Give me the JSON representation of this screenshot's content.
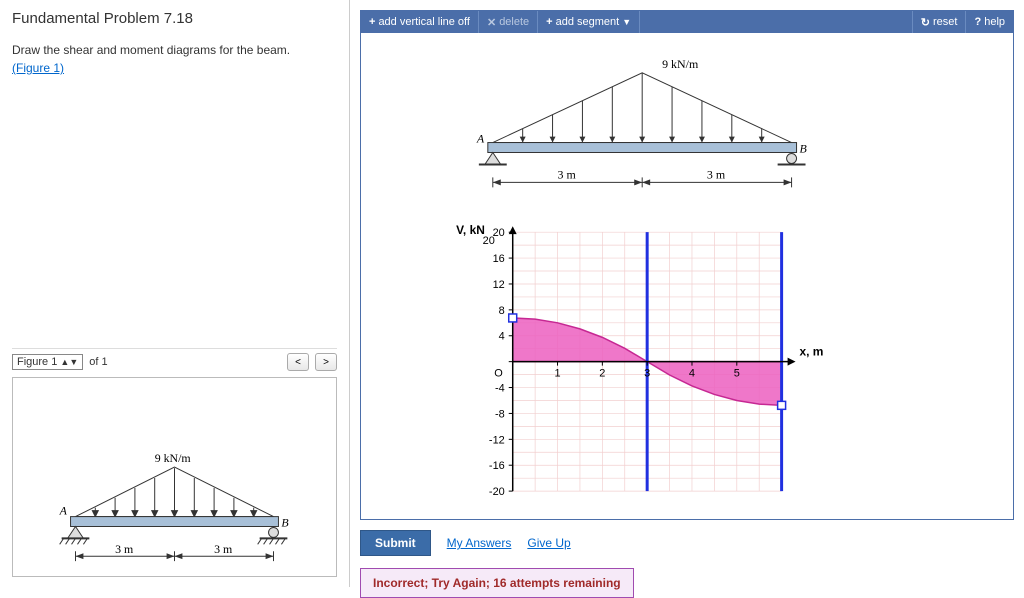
{
  "problem": {
    "title": "Fundamental Problem 7.18",
    "description": "Draw the shear and moment diagrams for the beam.",
    "figure_link": "(Figure 1)"
  },
  "figure_nav": {
    "selected": "Figure 1",
    "of": "of 1",
    "prev": "<",
    "next": ">"
  },
  "beam": {
    "load_label": "9 kN/m",
    "point_A": "A",
    "point_B": "B",
    "span_left": "3 m",
    "span_right": "3 m"
  },
  "toolbar": {
    "add_vline": "add vertical line off",
    "delete": "delete",
    "add_segment": "add segment",
    "reset": "reset",
    "help": "help"
  },
  "chart_data": {
    "type": "line",
    "title": "",
    "xlabel": "x, m",
    "ylabel": "V, kN",
    "xlim": [
      0,
      6
    ],
    "ylim": [
      -20,
      20
    ],
    "xticks": [
      "O",
      "1",
      "2",
      "3",
      "4",
      "5"
    ],
    "yticks": [
      20,
      16,
      12,
      8,
      4,
      0,
      -4,
      -8,
      -12,
      -16,
      -20
    ],
    "x": [
      0,
      0.5,
      1,
      1.5,
      2,
      2.5,
      3,
      3.5,
      4,
      4.5,
      5,
      5.5,
      6
    ],
    "y": [
      6.75,
      6.5625,
      6.0,
      5.0625,
      3.75,
      2.0625,
      0,
      -2.0625,
      -3.75,
      -5.0625,
      -6.0,
      -6.5625,
      -6.75
    ],
    "vlines": [
      3,
      6
    ],
    "handles": [
      [
        0,
        6.75
      ],
      [
        6,
        -6.75
      ]
    ]
  },
  "actions": {
    "submit": "Submit",
    "my_answers": "My Answers",
    "give_up": "Give Up"
  },
  "feedback": "Incorrect; Try Again; 16 attempts remaining"
}
